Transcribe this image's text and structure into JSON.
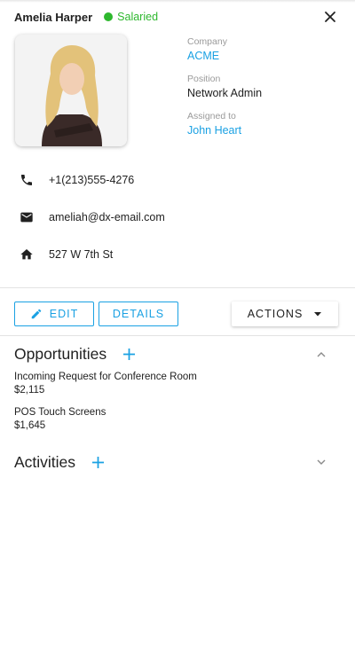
{
  "header": {
    "name": "Amelia Harper",
    "status": "Salaried",
    "status_color": "#2eb82e"
  },
  "colors": {
    "accent": "#1aa1e3",
    "text": "#212121",
    "muted": "#9a9a9a",
    "divider": "#e3e3e3"
  },
  "details": {
    "company_label": "Company",
    "company": "ACME",
    "position_label": "Position",
    "position": "Network Admin",
    "assigned_label": "Assigned to",
    "assigned": "John Heart"
  },
  "contacts": {
    "phone_icon": "phone-icon",
    "phone": "+1(213)555-4276",
    "email_icon": "mail-icon",
    "email": "ameliah@dx-email.com",
    "address_icon": "home-icon",
    "address": "527 W 7th St"
  },
  "toolbar": {
    "edit_label": "EDIT",
    "details_label": "DETAILS",
    "actions_label": "ACTIONS"
  },
  "opportunities": {
    "title": "Opportunities",
    "items": [
      {
        "name": "Incoming Request for Conference Room",
        "amount": "$2,115"
      },
      {
        "name": "POS Touch Screens",
        "amount": "$1,645"
      }
    ]
  },
  "activities": {
    "title": "Activities"
  }
}
